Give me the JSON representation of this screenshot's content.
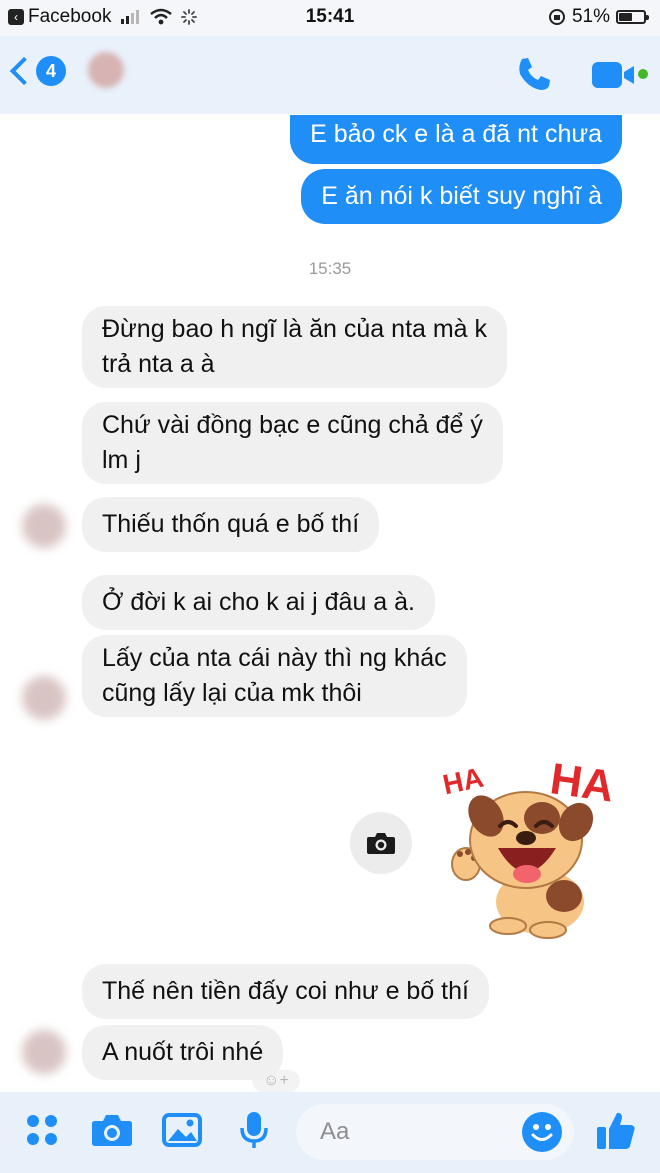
{
  "status_bar": {
    "back_app_label": "Facebook",
    "time": "15:41",
    "battery_text": "51%",
    "battery_level": 0.51
  },
  "header": {
    "unread_count": "4",
    "contact_name": "",
    "icons": {
      "back": "chevron-left-icon",
      "call": "phone-icon",
      "video": "video-camera-icon"
    }
  },
  "messages": {
    "outgoing": [
      "E bảo ck e là a đã nt chưa",
      "E ăn nói k biết suy nghĩ à"
    ],
    "timestamp": "15:35",
    "group1": [
      [
        "Đừng bao h ngĩ là ăn của nta mà k",
        "trả nta a à"
      ],
      [
        "Chứ vài đồng bạc e cũng chả để ý",
        "lm j"
      ],
      [
        "Thiếu thốn quá e bố thí"
      ]
    ],
    "group2": [
      [
        "Ở đời k ai cho k ai j đâu a à."
      ],
      [
        "Lấy của nta cái này thì ng khác",
        "cũng lấy lại của mk thôi"
      ]
    ],
    "sticker_text_left": "HA",
    "sticker_text_right": "HA",
    "group3": [
      [
        "Thế nên tiền đấy coi như e bố thí"
      ],
      [
        "A nuốt trôi nhé"
      ]
    ]
  },
  "composer": {
    "placeholder": "Aa",
    "icons": [
      "apps-icon",
      "camera-icon",
      "image-icon",
      "microphone-icon",
      "emoji-icon",
      "thumbs-up-icon"
    ]
  },
  "colors": {
    "accent": "#1f8ff7",
    "incoming_bubble": "#f1f0f0",
    "header_bg": "#e9f1fb",
    "online": "#42b72a"
  }
}
